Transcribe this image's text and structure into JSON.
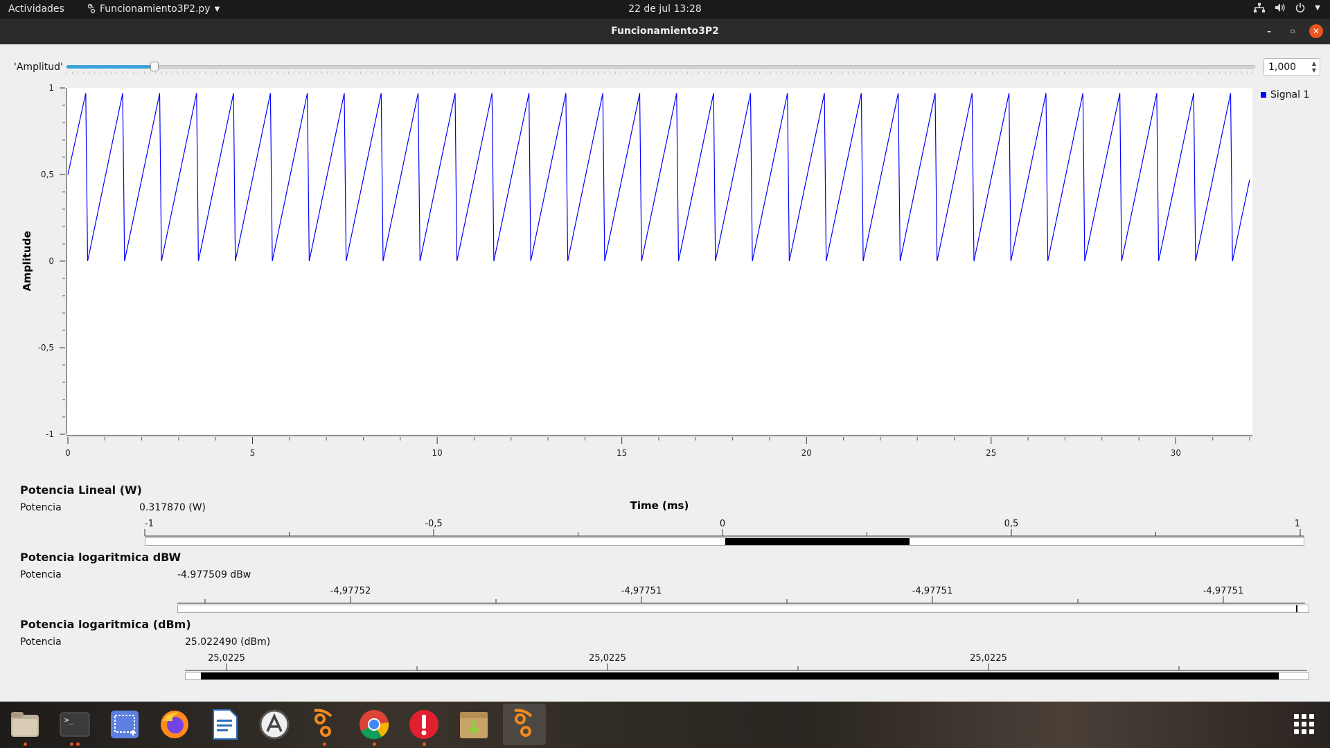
{
  "topbar": {
    "activities": "Actividades",
    "app_menu": "Funcionamiento3P2.py",
    "clock": "22 de jul  13:28",
    "tray_icons": [
      "network-icon",
      "volume-icon",
      "power-icon",
      "chevron-down-icon"
    ]
  },
  "window": {
    "title": "Funcionamiento3P2",
    "buttons": [
      "minimize",
      "maximize",
      "close"
    ]
  },
  "amplitude_control": {
    "label": "'Amplitud'",
    "value": "1,000",
    "slider_fraction": 0.043
  },
  "time_sink": {
    "legend": "Signal 1",
    "legend_color": "#0000ff",
    "xlabel": "Time (ms)",
    "ylabel": "Amplitude",
    "xticks": [
      "0",
      "5",
      "10",
      "15",
      "20",
      "25",
      "30"
    ],
    "yticks": [
      "1",
      "0,5",
      "0",
      "-0,5",
      "-1"
    ]
  },
  "chart_data": {
    "type": "line",
    "title": "",
    "xlabel": "Time (ms)",
    "ylabel": "Amplitude",
    "xlim": [
      0,
      32
    ],
    "ylim": [
      -1,
      1
    ],
    "grid": false,
    "legend_placement": "top-right",
    "series": [
      {
        "name": "Signal 1",
        "waveform": "sawtooth",
        "period_ms": 1.0,
        "min": 0,
        "max": 0.97,
        "start_value": 0.5,
        "end_value": 0.47,
        "x_end": 32
      }
    ]
  },
  "sinks": [
    {
      "title": "Potencia Lineal (W)",
      "row_label": "Potencia",
      "value_text": "0.317870 (W)",
      "scale_labels": [
        "-1",
        "-0,5",
        "0",
        "0,5",
        "1"
      ],
      "range": [
        -1,
        1
      ],
      "value": 0.31787
    },
    {
      "title": "Potencia logaritmica dBW",
      "row_label": "Potencia",
      "value_text": "-4.977509 dBw",
      "scale_labels": [
        "-4,97752",
        "-4,97751",
        "-4,97751",
        "-4,97751"
      ],
      "range": [
        -4.977523,
        -4.977507
      ],
      "value": -4.977509
    },
    {
      "title": "Potencia logaritmica (dBm)",
      "row_label": "Potencia",
      "value_text": "25.022490 (dBm)",
      "scale_labels": [
        "25,0225",
        "25,0225",
        "25,0225"
      ],
      "range": [
        25.02248,
        25.0225
      ],
      "value": 25.02249
    }
  ],
  "dock": {
    "items": [
      "files-icon",
      "terminal-icon",
      "screenshot-icon",
      "firefox-icon",
      "libreoffice-writer-icon",
      "software-center-icon",
      "gnuradio-icon",
      "chrome-icon",
      "error-report-icon",
      "archive-manager-icon",
      "gnuradio-active-icon"
    ],
    "apps_grid": "show-applications-icon"
  },
  "colors": {
    "accent": "#e95420",
    "slider_fill": "#3ba2d6",
    "signal": "#0000ff"
  }
}
